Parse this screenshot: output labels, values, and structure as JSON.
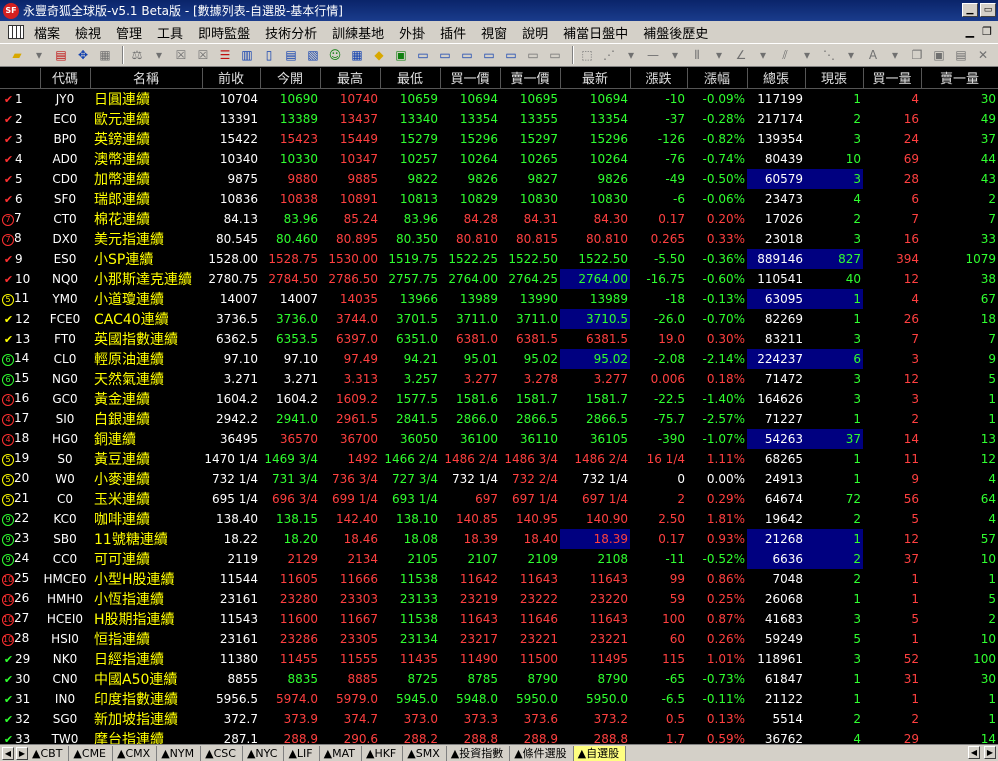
{
  "window": {
    "title": "永豐奇狐全球版-v5.1 Beta版 - [數據列表-自選股-基本行情]",
    "icon_text": "SF"
  },
  "menu": [
    "檔案",
    "檢視",
    "管理",
    "工具",
    "即時監盤",
    "技術分析",
    "訓練基地",
    "外掛",
    "插件",
    "視窗",
    "說明",
    "補當日盤中",
    "補盤後歷史"
  ],
  "columns": [
    "",
    "代碼",
    "名稱",
    "前收",
    "今開",
    "最高",
    "最低",
    "買一價",
    "賣一價",
    "最新",
    "漲跌",
    "漲幅",
    "總張",
    "現張",
    "買一量",
    "賣一量"
  ],
  "rows": [
    {
      "n": "1",
      "mk": "check",
      "code": "JY0",
      "name": "日圓連續",
      "prev": "10704",
      "open": "10690",
      "high": "10740",
      "low": "10659",
      "bid": "10694",
      "ask": "10695",
      "last": "10694",
      "chg": "-10",
      "pct": "-0.09%",
      "vol": "117199",
      "cur": "1",
      "bq": "4",
      "aq": "30",
      "oc": "g",
      "hc": "r",
      "lc": "g",
      "bc": "g",
      "ac": "g",
      "lastc": "g",
      "chgc": "g",
      "hlLast": false,
      "hlVol": false
    },
    {
      "n": "2",
      "mk": "check",
      "code": "EC0",
      "name": "歐元連續",
      "prev": "13391",
      "open": "13389",
      "high": "13437",
      "low": "13340",
      "bid": "13354",
      "ask": "13355",
      "last": "13354",
      "chg": "-37",
      "pct": "-0.28%",
      "vol": "217174",
      "cur": "2",
      "bq": "16",
      "aq": "49",
      "oc": "g",
      "hc": "r",
      "lc": "g",
      "bc": "g",
      "ac": "g",
      "lastc": "g",
      "chgc": "g"
    },
    {
      "n": "3",
      "mk": "check",
      "code": "BP0",
      "name": "英鎊連續",
      "prev": "15422",
      "open": "15423",
      "high": "15449",
      "low": "15279",
      "bid": "15296",
      "ask": "15297",
      "last": "15296",
      "chg": "-126",
      "pct": "-0.82%",
      "vol": "139354",
      "cur": "3",
      "bq": "24",
      "aq": "37",
      "oc": "r",
      "hc": "r",
      "lc": "g",
      "bc": "g",
      "ac": "g",
      "lastc": "g",
      "chgc": "g"
    },
    {
      "n": "4",
      "mk": "check",
      "code": "AD0",
      "name": "澳幣連續",
      "prev": "10340",
      "open": "10330",
      "high": "10347",
      "low": "10257",
      "bid": "10264",
      "ask": "10265",
      "last": "10264",
      "chg": "-76",
      "pct": "-0.74%",
      "vol": "80439",
      "cur": "10",
      "bq": "69",
      "aq": "44",
      "oc": "g",
      "hc": "r",
      "lc": "g",
      "bc": "g",
      "ac": "g",
      "lastc": "g",
      "chgc": "g"
    },
    {
      "n": "5",
      "mk": "check",
      "code": "CD0",
      "name": "加幣連續",
      "prev": "9875",
      "open": "9880",
      "high": "9885",
      "low": "9822",
      "bid": "9826",
      "ask": "9827",
      "last": "9826",
      "chg": "-49",
      "pct": "-0.50%",
      "vol": "60579",
      "cur": "3",
      "bq": "28",
      "aq": "43",
      "oc": "r",
      "hc": "r",
      "lc": "g",
      "bc": "g",
      "ac": "g",
      "lastc": "g",
      "chgc": "g",
      "hlVol": true
    },
    {
      "n": "6",
      "mk": "check",
      "code": "SF0",
      "name": "瑞郎連續",
      "prev": "10836",
      "open": "10838",
      "high": "10891",
      "low": "10813",
      "bid": "10829",
      "ask": "10830",
      "last": "10830",
      "chg": "-6",
      "pct": "-0.06%",
      "vol": "23473",
      "cur": "4",
      "bq": "6",
      "aq": "2",
      "oc": "r",
      "hc": "r",
      "lc": "g",
      "bc": "g",
      "ac": "g",
      "lastc": "g",
      "chgc": "g"
    },
    {
      "n": "7",
      "mk": "circle",
      "mkt": "7",
      "code": "CT0",
      "name": "棉花連續",
      "prev": "84.13",
      "open": "83.96",
      "high": "85.24",
      "low": "83.96",
      "bid": "84.28",
      "ask": "84.31",
      "last": "84.30",
      "chg": "0.17",
      "pct": "0.20%",
      "vol": "17026",
      "cur": "2",
      "bq": "7",
      "aq": "7",
      "oc": "g",
      "hc": "r",
      "lc": "g",
      "bc": "r",
      "ac": "r",
      "lastc": "r",
      "chgc": "r"
    },
    {
      "n": "8",
      "mk": "circle",
      "mkt": "7",
      "code": "DX0",
      "name": "美元指連續",
      "prev": "80.545",
      "open": "80.460",
      "high": "80.895",
      "low": "80.350",
      "bid": "80.810",
      "ask": "80.815",
      "last": "80.810",
      "chg": "0.265",
      "pct": "0.33%",
      "vol": "23018",
      "cur": "3",
      "bq": "16",
      "aq": "33",
      "oc": "g",
      "hc": "r",
      "lc": "g",
      "bc": "r",
      "ac": "r",
      "lastc": "r",
      "chgc": "r"
    },
    {
      "n": "9",
      "mk": "check",
      "code": "ES0",
      "name": "小SP連續",
      "prev": "1528.00",
      "open": "1528.75",
      "high": "1530.00",
      "low": "1519.75",
      "bid": "1522.25",
      "ask": "1522.50",
      "last": "1522.50",
      "chg": "-5.50",
      "pct": "-0.36%",
      "vol": "889146",
      "cur": "827",
      "bq": "394",
      "aq": "1079",
      "oc": "r",
      "hc": "r",
      "lc": "g",
      "bc": "g",
      "ac": "g",
      "lastc": "g",
      "chgc": "g",
      "hlVol": true
    },
    {
      "n": "10",
      "mk": "check",
      "code": "NQ0",
      "name": "小那斯達克連續",
      "prev": "2780.75",
      "open": "2784.50",
      "high": "2786.50",
      "low": "2757.75",
      "bid": "2764.00",
      "ask": "2764.25",
      "last": "2764.00",
      "chg": "-16.75",
      "pct": "-0.60%",
      "vol": "110541",
      "cur": "40",
      "bq": "12",
      "aq": "38",
      "oc": "r",
      "hc": "r",
      "lc": "g",
      "bc": "g",
      "ac": "g",
      "lastc": "g",
      "chgc": "g",
      "hlLast": true
    },
    {
      "n": "11",
      "mk": "circley",
      "mkt": "5",
      "code": "YM0",
      "name": "小道瓊連續",
      "prev": "14007",
      "open": "14007",
      "high": "14035",
      "low": "13966",
      "bid": "13989",
      "ask": "13990",
      "last": "13989",
      "chg": "-18",
      "pct": "-0.13%",
      "vol": "63095",
      "cur": "1",
      "bq": "4",
      "aq": "67",
      "oc": "w",
      "hc": "r",
      "lc": "g",
      "bc": "g",
      "ac": "g",
      "lastc": "g",
      "chgc": "g",
      "hlVol": true
    },
    {
      "n": "12",
      "mk": "checky",
      "code": "FCE0",
      "name": "CAC40連續",
      "prev": "3736.5",
      "open": "3736.0",
      "high": "3744.0",
      "low": "3701.5",
      "bid": "3711.0",
      "ask": "3711.0",
      "last": "3710.5",
      "chg": "-26.0",
      "pct": "-0.70%",
      "vol": "82269",
      "cur": "1",
      "bq": "26",
      "aq": "18",
      "oc": "g",
      "hc": "r",
      "lc": "g",
      "bc": "g",
      "ac": "g",
      "lastc": "g",
      "chgc": "g",
      "hlLast": true
    },
    {
      "n": "13",
      "mk": "checky",
      "code": "FT0",
      "name": "英國指數連續",
      "prev": "6362.5",
      "open": "6353.5",
      "high": "6397.0",
      "low": "6351.0",
      "bid": "6381.0",
      "ask": "6381.5",
      "last": "6381.5",
      "chg": "19.0",
      "pct": "0.30%",
      "vol": "83211",
      "cur": "3",
      "bq": "7",
      "aq": "7",
      "oc": "g",
      "hc": "r",
      "lc": "g",
      "bc": "r",
      "ac": "r",
      "lastc": "r",
      "chgc": "r"
    },
    {
      "n": "14",
      "mk": "circleg",
      "mkt": "6",
      "code": "CL0",
      "name": "輕原油連續",
      "prev": "97.10",
      "open": "97.10",
      "high": "97.49",
      "low": "94.21",
      "bid": "95.01",
      "ask": "95.02",
      "last": "95.02",
      "chg": "-2.08",
      "pct": "-2.14%",
      "vol": "224237",
      "cur": "6",
      "bq": "3",
      "aq": "9",
      "oc": "w",
      "hc": "r",
      "lc": "g",
      "bc": "g",
      "ac": "g",
      "lastc": "g",
      "chgc": "g",
      "hlLast": true,
      "hlVol": true
    },
    {
      "n": "15",
      "mk": "circleg",
      "mkt": "6",
      "code": "NG0",
      "name": "天然氣連續",
      "prev": "3.271",
      "open": "3.271",
      "high": "3.313",
      "low": "3.257",
      "bid": "3.277",
      "ask": "3.278",
      "last": "3.277",
      "chg": "0.006",
      "pct": "0.18%",
      "vol": "71472",
      "cur": "3",
      "bq": "12",
      "aq": "5",
      "oc": "w",
      "hc": "r",
      "lc": "g",
      "bc": "r",
      "ac": "r",
      "lastc": "r",
      "chgc": "r"
    },
    {
      "n": "16",
      "mk": "circle",
      "mkt": "4",
      "code": "GC0",
      "name": "黃金連續",
      "prev": "1604.2",
      "open": "1604.2",
      "high": "1609.2",
      "low": "1577.5",
      "bid": "1581.6",
      "ask": "1581.7",
      "last": "1581.7",
      "chg": "-22.5",
      "pct": "-1.40%",
      "vol": "164626",
      "cur": "3",
      "bq": "3",
      "aq": "1",
      "oc": "w",
      "hc": "r",
      "lc": "g",
      "bc": "g",
      "ac": "g",
      "lastc": "g",
      "chgc": "g"
    },
    {
      "n": "17",
      "mk": "circle",
      "mkt": "4",
      "code": "SI0",
      "name": "白銀連續",
      "prev": "2942.2",
      "open": "2941.0",
      "high": "2961.5",
      "low": "2841.5",
      "bid": "2866.0",
      "ask": "2866.5",
      "last": "2866.5",
      "chg": "-75.7",
      "pct": "-2.57%",
      "vol": "71227",
      "cur": "1",
      "bq": "2",
      "aq": "1",
      "oc": "g",
      "hc": "r",
      "lc": "g",
      "bc": "g",
      "ac": "g",
      "lastc": "g",
      "chgc": "g"
    },
    {
      "n": "18",
      "mk": "circle",
      "mkt": "4",
      "code": "HG0",
      "name": "銅連續",
      "prev": "36495",
      "open": "36570",
      "high": "36700",
      "low": "36050",
      "bid": "36100",
      "ask": "36110",
      "last": "36105",
      "chg": "-390",
      "pct": "-1.07%",
      "vol": "54263",
      "cur": "37",
      "bq": "14",
      "aq": "13",
      "oc": "r",
      "hc": "r",
      "lc": "g",
      "bc": "g",
      "ac": "g",
      "lastc": "g",
      "chgc": "g",
      "hlVol": true
    },
    {
      "n": "19",
      "mk": "circley",
      "mkt": "5",
      "code": "S0",
      "name": "黃豆連續",
      "prev": "1470 1/4",
      "open": "1469 3/4",
      "high": "1492",
      "low": "1466 2/4",
      "bid": "1486 2/4",
      "ask": "1486 3/4",
      "last": "1486 2/4",
      "chg": "16 1/4",
      "pct": "1.11%",
      "vol": "68265",
      "cur": "1",
      "bq": "11",
      "aq": "12",
      "oc": "g",
      "hc": "r",
      "lc": "g",
      "bc": "r",
      "ac": "r",
      "lastc": "r",
      "chgc": "r"
    },
    {
      "n": "20",
      "mk": "circley",
      "mkt": "5",
      "code": "W0",
      "name": "小麥連續",
      "prev": "732 1/4",
      "open": "731 3/4",
      "high": "736 3/4",
      "low": "727 3/4",
      "bid": "732 1/4",
      "ask": "732 2/4",
      "last": "732 1/4",
      "chg": "0",
      "pct": "0.00%",
      "vol": "24913",
      "cur": "1",
      "bq": "9",
      "aq": "4",
      "oc": "g",
      "hc": "r",
      "lc": "g",
      "bc": "w",
      "ac": "r",
      "lastc": "w",
      "chgc": "w"
    },
    {
      "n": "21",
      "mk": "circley",
      "mkt": "5",
      "code": "C0",
      "name": "玉米連續",
      "prev": "695 1/4",
      "open": "696 3/4",
      "high": "699 1/4",
      "low": "693 1/4",
      "bid": "697",
      "ask": "697 1/4",
      "last": "697 1/4",
      "chg": "2",
      "pct": "0.29%",
      "vol": "64674",
      "cur": "72",
      "bq": "56",
      "aq": "64",
      "oc": "r",
      "hc": "r",
      "lc": "g",
      "bc": "r",
      "ac": "r",
      "lastc": "r",
      "chgc": "r"
    },
    {
      "n": "22",
      "mk": "circleg",
      "mkt": "9",
      "code": "KC0",
      "name": "咖啡連續",
      "prev": "138.40",
      "open": "138.15",
      "high": "142.40",
      "low": "138.10",
      "bid": "140.85",
      "ask": "140.95",
      "last": "140.90",
      "chg": "2.50",
      "pct": "1.81%",
      "vol": "19642",
      "cur": "2",
      "bq": "5",
      "aq": "4",
      "oc": "g",
      "hc": "r",
      "lc": "g",
      "bc": "r",
      "ac": "r",
      "lastc": "r",
      "chgc": "r"
    },
    {
      "n": "23",
      "mk": "circleg",
      "mkt": "9",
      "code": "SB0",
      "name": "11號糖連續",
      "prev": "18.22",
      "open": "18.20",
      "high": "18.46",
      "low": "18.08",
      "bid": "18.39",
      "ask": "18.40",
      "last": "18.39",
      "chg": "0.17",
      "pct": "0.93%",
      "vol": "21268",
      "cur": "1",
      "bq": "12",
      "aq": "57",
      "oc": "g",
      "hc": "r",
      "lc": "g",
      "bc": "r",
      "ac": "r",
      "lastc": "r",
      "chgc": "r",
      "hlLast": true,
      "hlVol": true
    },
    {
      "n": "24",
      "mk": "circleg",
      "mkt": "9",
      "code": "CC0",
      "name": "可可連續",
      "prev": "2119",
      "open": "2129",
      "high": "2134",
      "low": "2105",
      "bid": "2107",
      "ask": "2109",
      "last": "2108",
      "chg": "-11",
      "pct": "-0.52%",
      "vol": "6636",
      "cur": "2",
      "bq": "37",
      "aq": "10",
      "oc": "r",
      "hc": "r",
      "lc": "g",
      "bc": "g",
      "ac": "g",
      "lastc": "g",
      "chgc": "g",
      "hlVol": true
    },
    {
      "n": "25",
      "mk": "circle",
      "mkt": "10",
      "code": "HMCE0",
      "name": "小型H股連續",
      "prev": "11544",
      "open": "11605",
      "high": "11666",
      "low": "11538",
      "bid": "11642",
      "ask": "11643",
      "last": "11643",
      "chg": "99",
      "pct": "0.86%",
      "vol": "7048",
      "cur": "2",
      "bq": "1",
      "aq": "1",
      "oc": "r",
      "hc": "r",
      "lc": "g",
      "bc": "r",
      "ac": "r",
      "lastc": "r",
      "chgc": "r"
    },
    {
      "n": "26",
      "mk": "circle",
      "mkt": "10",
      "code": "HMH0",
      "name": "小恆指連續",
      "prev": "23161",
      "open": "23280",
      "high": "23303",
      "low": "23133",
      "bid": "23219",
      "ask": "23222",
      "last": "23220",
      "chg": "59",
      "pct": "0.25%",
      "vol": "26068",
      "cur": "1",
      "bq": "1",
      "aq": "5",
      "oc": "r",
      "hc": "r",
      "lc": "g",
      "bc": "r",
      "ac": "r",
      "lastc": "r",
      "chgc": "r"
    },
    {
      "n": "27",
      "mk": "circle",
      "mkt": "10",
      "code": "HCEI0",
      "name": "H股期指連續",
      "prev": "11543",
      "open": "11600",
      "high": "11667",
      "low": "11538",
      "bid": "11643",
      "ask": "11646",
      "last": "11643",
      "chg": "100",
      "pct": "0.87%",
      "vol": "41683",
      "cur": "3",
      "bq": "5",
      "aq": "2",
      "oc": "r",
      "hc": "r",
      "lc": "g",
      "bc": "r",
      "ac": "r",
      "lastc": "r",
      "chgc": "r"
    },
    {
      "n": "28",
      "mk": "circle",
      "mkt": "10",
      "code": "HSI0",
      "name": "恒指連續",
      "prev": "23161",
      "open": "23286",
      "high": "23305",
      "low": "23134",
      "bid": "23217",
      "ask": "23221",
      "last": "23221",
      "chg": "60",
      "pct": "0.26%",
      "vol": "59249",
      "cur": "5",
      "bq": "1",
      "aq": "10",
      "oc": "r",
      "hc": "r",
      "lc": "g",
      "bc": "r",
      "ac": "r",
      "lastc": "r",
      "chgc": "r"
    },
    {
      "n": "29",
      "mk": "checkg",
      "code": "NK0",
      "name": "日經指連續",
      "prev": "11380",
      "open": "11455",
      "high": "11555",
      "low": "11435",
      "bid": "11490",
      "ask": "11500",
      "last": "11495",
      "chg": "115",
      "pct": "1.01%",
      "vol": "118961",
      "cur": "3",
      "bq": "52",
      "aq": "100",
      "oc": "r",
      "hc": "r",
      "lc": "r",
      "bc": "r",
      "ac": "r",
      "lastc": "r",
      "chgc": "r"
    },
    {
      "n": "30",
      "mk": "checkg",
      "code": "CN0",
      "name": "中國A50連續",
      "prev": "8855",
      "open": "8835",
      "high": "8885",
      "low": "8725",
      "bid": "8785",
      "ask": "8790",
      "last": "8790",
      "chg": "-65",
      "pct": "-0.73%",
      "vol": "61847",
      "cur": "1",
      "bq": "31",
      "aq": "30",
      "oc": "g",
      "hc": "r",
      "lc": "g",
      "bc": "g",
      "ac": "g",
      "lastc": "g",
      "chgc": "g"
    },
    {
      "n": "31",
      "mk": "checkg",
      "code": "IN0",
      "name": "印度指數連續",
      "prev": "5956.5",
      "open": "5974.0",
      "high": "5979.0",
      "low": "5945.0",
      "bid": "5948.0",
      "ask": "5950.0",
      "last": "5950.0",
      "chg": "-6.5",
      "pct": "-0.11%",
      "vol": "21122",
      "cur": "1",
      "bq": "1",
      "aq": "1",
      "oc": "r",
      "hc": "r",
      "lc": "g",
      "bc": "g",
      "ac": "g",
      "lastc": "g",
      "chgc": "g"
    },
    {
      "n": "32",
      "mk": "checkg",
      "code": "SG0",
      "name": "新加坡指連續",
      "prev": "372.7",
      "open": "373.9",
      "high": "374.7",
      "low": "373.0",
      "bid": "373.3",
      "ask": "373.6",
      "last": "373.2",
      "chg": "0.5",
      "pct": "0.13%",
      "vol": "5514",
      "cur": "2",
      "bq": "2",
      "aq": "1",
      "oc": "r",
      "hc": "r",
      "lc": "r",
      "bc": "r",
      "ac": "r",
      "lastc": "r",
      "chgc": "r"
    },
    {
      "n": "33",
      "mk": "checkg",
      "code": "TW0",
      "name": "摩台指連續",
      "prev": "287.1",
      "open": "288.9",
      "high": "290.6",
      "low": "288.2",
      "bid": "288.8",
      "ask": "288.9",
      "last": "288.8",
      "chg": "1.7",
      "pct": "0.59%",
      "vol": "36762",
      "cur": "4",
      "bq": "29",
      "aq": "14",
      "oc": "r",
      "hc": "r",
      "lc": "r",
      "bc": "r",
      "ac": "r",
      "lastc": "r",
      "chgc": "r"
    }
  ],
  "tabs": [
    "CBT",
    "CME",
    "CMX",
    "NYM",
    "CSC",
    "NYC",
    "LIF",
    "MAT",
    "HKF",
    "SMX",
    "投資指數",
    "條件選股",
    "自選股"
  ],
  "active_tab": "自選股",
  "colors": {
    "up": "#ff4040",
    "down": "#30ff30",
    "name": "#ffff00",
    "highlight": "#000080"
  }
}
